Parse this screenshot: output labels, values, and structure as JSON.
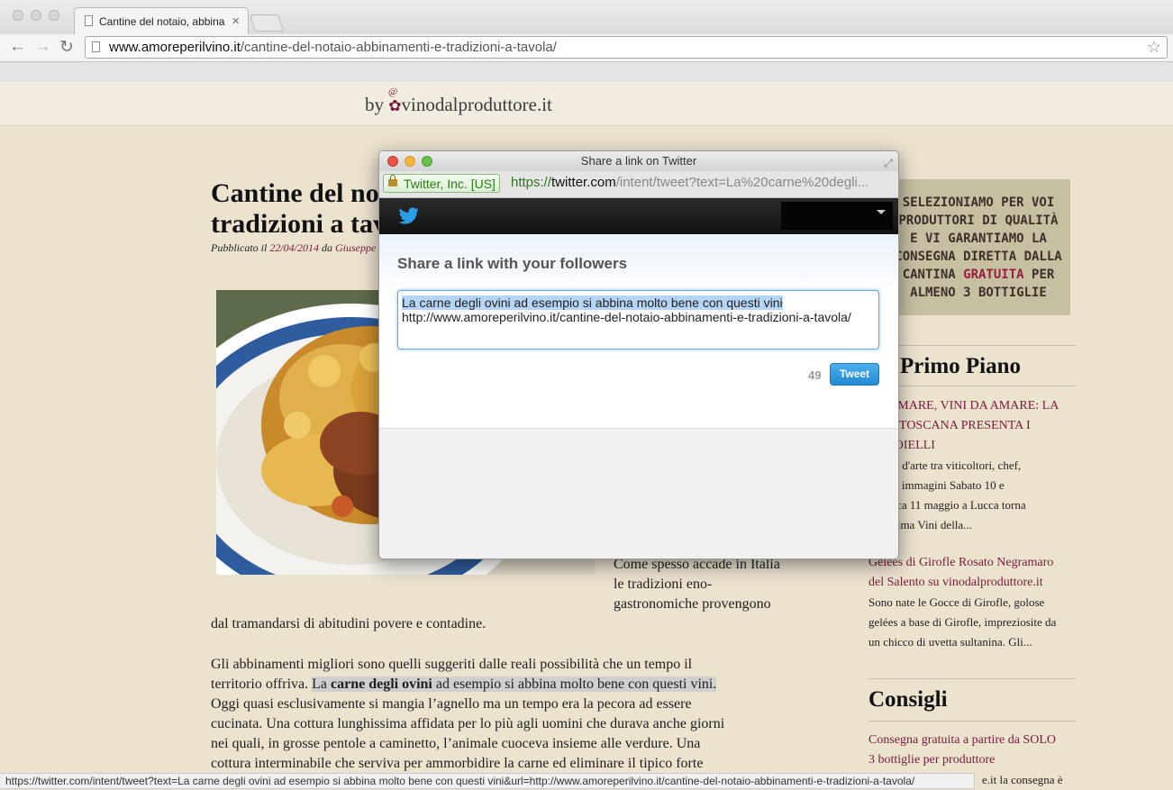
{
  "browser": {
    "tab_title": "Cantine del notaio, abbinamenti e tradizioni a tavola",
    "tab_close": "×",
    "url_domain": "www.amoreperilvino.it",
    "url_path": "/cantine-del-notaio-abbinamenti-e-tradizioni-a-tavola/",
    "status_url": "https://twitter.com/intent/tweet?text=La carne degli ovini ad esempio si abbina molto bene con questi vini&url=http://www.amoreperilvino.it/cantine-del-notaio-abbinamenti-e-tradizioni-a-tavola/"
  },
  "site": {
    "byline_prefix": "by",
    "byline_brand": "vinodalproduttore.it"
  },
  "article": {
    "title_line1": "Cantine del notaio, abbinamenti e",
    "title_line2": "tradizioni a tavola",
    "published_prefix": "Pubblicato il",
    "published_date": "22/04/2014",
    "published_by": "da",
    "published_author": "Giuseppe",
    "intro_lines": [
      "Come spesso accade in Italia",
      "le tradizioni eno-",
      "gastronomiche provengono"
    ],
    "intro_tail": "dal tramandarsi di abitudini povere e contadine.",
    "p2_line1": "Gli abbinamenti migliori sono quelli suggeriti dalle reali possibilità che un tempo il",
    "p2_line2_a": "territorio offriva.",
    "p2_line2_b": "La",
    "p2_line2_bold": "carne degli ovini",
    "p2_line2_c": "ad esempio si abbina molto bene con questi vini.",
    "p2_line3": "Oggi quasi esclusivamente si mangia l’agnello ma un tempo era la pecora ad essere",
    "p2_line4": "cucinata. Una cottura lunghissima affidata per lo più agli uomini che durava anche giorni",
    "p2_line5": "nei quali, in grosse pentole a caminetto, l’animale cuoceva insieme alle verdure. Una",
    "p2_line6": "cottura interminabile che serviva per ammorbidire la carne ed eliminare il tipico forte"
  },
  "sidebar": {
    "promo_lines": [
      "SELEZIONIAMO PER VOI",
      "PRODUTTORI DI QUALITÀ",
      "E VI GARANTIAMO LA",
      "CONSEGNA DIRETTA DALLA"
    ],
    "promo_last_a": "CANTINA",
    "promo_last_red": "GRATUITA",
    "promo_last_b": "PER",
    "promo_last_line": "ALMENO 3 BOTTIGLIE",
    "heading1": "Primo Piano",
    "item1_title_lines": [
      "DI MARE, VINI DA AMARE: LA",
      "TA TOSCANA PRESENTA I",
      "GIOIELLI"
    ],
    "item1_text_lines": [
      "rsi d'arte tra viticoltori, chef,",
      "i e immagini Sabato 10 e",
      "nica 11 maggio a Lucca torna",
      "prima Vini della..."
    ],
    "item2_title_lines": [
      "Gelées di Girofle Rosato Negramaro",
      "del Salento su vinodalproduttore.it"
    ],
    "item2_text_lines": [
      "Sono nate le Gocce di Girofle, golose",
      "gelées a base di Girofle, impreziosite da",
      "un chicco di uvetta sultanina. Gli..."
    ],
    "heading2": "Consigli",
    "item3_title_lines": [
      "Consegna gratuita a partire da SOLO",
      "3 bottiglie per produttore"
    ],
    "item3_text": "e.it la consegna è"
  },
  "popup": {
    "window_title": "Share a link on Twitter",
    "ev_label": "Twitter, Inc. [US]",
    "url_scheme": "https://",
    "url_domain": "twitter.com",
    "url_rest": "/intent/tweet?text=La%20carne%20degli...",
    "heading": "Share a link with your followers",
    "tweet_text_selected": "La carne degli ovini ad esempio si abbina molto bene con questi vini",
    "tweet_text_url": "http://www.amoreperilvino.it/cantine-del-notaio-abbinamenti-e-tradizioni-a-tavola/",
    "char_count": "49",
    "tweet_button": "Tweet"
  },
  "colors": {
    "twitter_blue": "#2a9de4",
    "brand_wine": "#7a1a3a",
    "page_bg": "#ece3cf",
    "promo_bg": "#c6c0a3"
  }
}
